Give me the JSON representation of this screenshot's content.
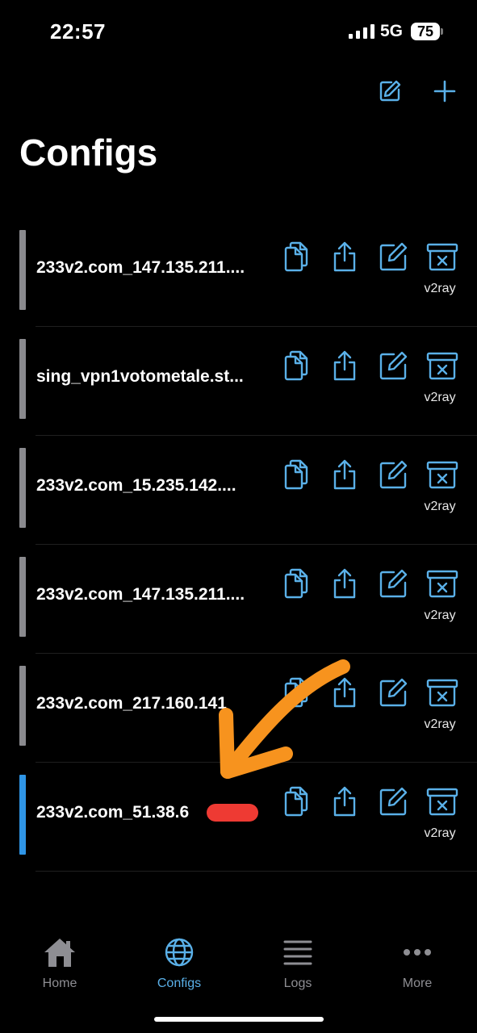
{
  "status_bar": {
    "time": "22:57",
    "network": "5G",
    "battery": "75"
  },
  "top_actions": {
    "edit_icon": "edit-icon",
    "add_icon": "plus-icon"
  },
  "title": "Configs",
  "accent_color": "#5ab0e8",
  "active_bar_color": "#2f95e6",
  "inactive_bar_color": "#8a8a8e",
  "configs": [
    {
      "name": "233v2.com_147.135.211....",
      "type": "v2ray",
      "active": false
    },
    {
      "name": "sing_vpn1votometale.st...",
      "type": "v2ray",
      "active": false
    },
    {
      "name": "233v2.com_15.235.142....",
      "type": "v2ray",
      "active": false
    },
    {
      "name": "233v2.com_147.135.211....",
      "type": "v2ray",
      "active": false
    },
    {
      "name": "233v2.com_217.160.141",
      "type": "v2ray",
      "active": false
    },
    {
      "name": "233v2.com_51.38.6",
      "type": "v2ray",
      "active": true
    }
  ],
  "tabs": [
    {
      "label": "Home",
      "icon": "house-icon",
      "selected": false
    },
    {
      "label": "Configs",
      "icon": "globe-icon",
      "selected": true
    },
    {
      "label": "Logs",
      "icon": "list-icon",
      "selected": false
    },
    {
      "label": "More",
      "icon": "ellipsis-icon",
      "selected": false
    }
  ]
}
